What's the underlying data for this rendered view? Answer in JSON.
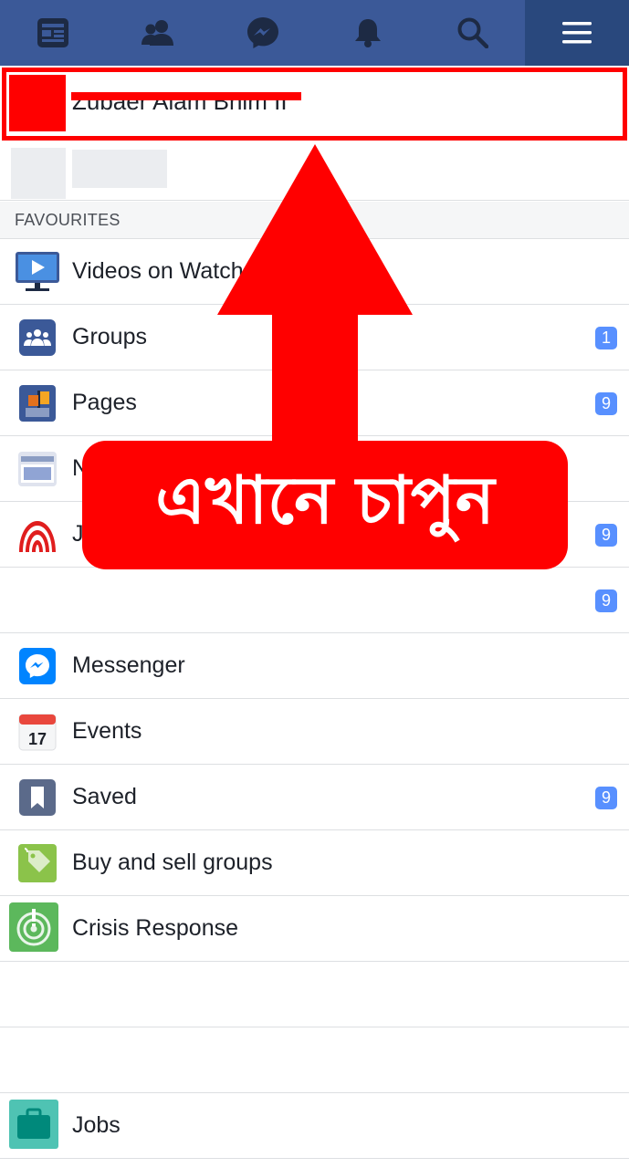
{
  "nav": {
    "items": [
      {
        "icon": "news-feed-icon"
      },
      {
        "icon": "friends-icon"
      },
      {
        "icon": "messenger-icon"
      },
      {
        "icon": "notifications-bell-icon"
      },
      {
        "icon": "search-icon"
      },
      {
        "icon": "menu-icon",
        "active": true
      }
    ],
    "background": "#3b5998",
    "active_background": "#29487d"
  },
  "profile": {
    "name": "Zubaer Alam Bhim II"
  },
  "favourites": {
    "header": "FAVOURITES"
  },
  "menu": [
    {
      "icon": "videos-on-watch-icon",
      "label": "Videos on Watch",
      "badge": ""
    },
    {
      "icon": "groups-icon",
      "label": "Groups",
      "badge": "1"
    },
    {
      "icon": "pages-icon",
      "label": "Pages",
      "badge": "9"
    },
    {
      "icon": "news-icon",
      "label": "N",
      "badge": ""
    },
    {
      "icon": "app-red-logo-icon",
      "label": "J",
      "badge": "9"
    },
    {
      "icon": "",
      "label": "",
      "badge": "9"
    },
    {
      "icon": "messenger-app-icon",
      "label": "Messenger",
      "badge": ""
    },
    {
      "icon": "events-calendar-icon",
      "label": "Events",
      "badge": ""
    },
    {
      "icon": "saved-bookmark-icon",
      "label": "Saved",
      "badge": "9"
    },
    {
      "icon": "buy-sell-tag-icon",
      "label": "Buy and sell groups",
      "badge": ""
    },
    {
      "icon": "crisis-response-icon",
      "label": "Crisis Response",
      "badge": ""
    },
    {
      "icon": "",
      "label": "",
      "badge": ""
    },
    {
      "icon": "",
      "label": "",
      "badge": ""
    },
    {
      "icon": "jobs-briefcase-icon",
      "label": "Jobs",
      "badge": ""
    }
  ],
  "annotation": {
    "callout_text": "এখানে চাপুন",
    "color": "#ff0000"
  },
  "colors": {
    "badge": "#5890ff",
    "divider": "#dddfe2"
  }
}
